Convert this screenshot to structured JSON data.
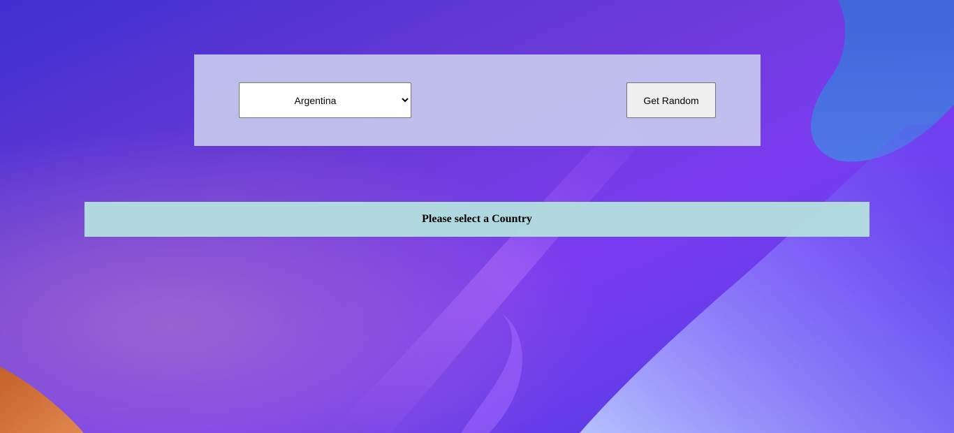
{
  "controls": {
    "country_select": {
      "selected": "Argentina",
      "options": [
        "Argentina"
      ]
    },
    "random_button_label": "Get Random"
  },
  "status": {
    "message": "Please select a Country"
  },
  "colors": {
    "background_primary": "#4a2fd8",
    "panel": "#cdd4f0",
    "status_bar": "#b4e1de"
  }
}
